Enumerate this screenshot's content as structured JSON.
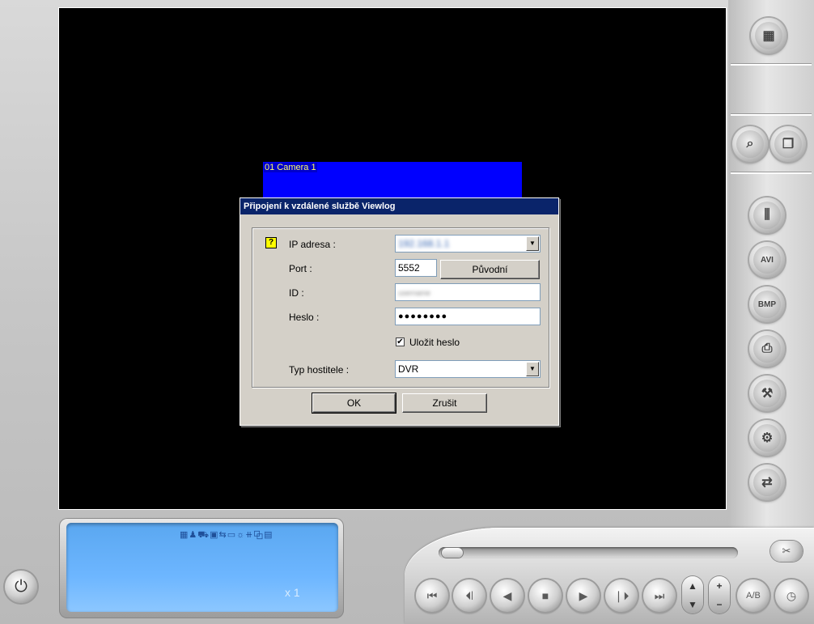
{
  "video": {
    "camera_label": "01 Camera 1"
  },
  "dialog": {
    "title": "Připojení k vzdálené službě Viewlog",
    "ip_label": "IP adresa :",
    "ip_value": "192.168.1.1",
    "port_label": "Port :",
    "port_value": "5552",
    "default_button": "Původní",
    "id_label": "ID :",
    "id_value": "username",
    "password_label": "Heslo :",
    "password_value": "●●●●●●●●",
    "save_password_label": "Uložit heslo",
    "save_password_checked": "✔",
    "host_type_label": "Typ hostitele :",
    "host_type_value": "DVR",
    "ok_button": "OK",
    "cancel_button": "Zrušit"
  },
  "lcd": {
    "status_icons": "▦♟⛟▣⇆▭☼⧺⧉▤",
    "speed": "x 1"
  },
  "right_buttons": [
    {
      "icon": "layout-grid-icon",
      "glyph": "▦"
    },
    {
      "icon": "search-doc-icon",
      "glyph": "⌕"
    },
    {
      "icon": "copy-doc-icon",
      "glyph": "❐"
    },
    {
      "icon": "sliders-icon",
      "glyph": "⫼"
    },
    {
      "icon": "avi-save-icon",
      "glyph": "AVI"
    },
    {
      "icon": "bmp-save-icon",
      "glyph": "BMP"
    },
    {
      "icon": "printer-icon",
      "glyph": "⎙"
    },
    {
      "icon": "tools-icon",
      "glyph": "⚒"
    },
    {
      "icon": "settings-wrench-icon",
      "glyph": "⚙"
    },
    {
      "icon": "remote-connect-icon",
      "glyph": "⇄"
    }
  ],
  "transport": {
    "first": "⏮",
    "prev_frame": "⏴❘",
    "rewind": "◀",
    "stop": "■",
    "play": "▶",
    "next_frame": "❘⏵",
    "last": "⏭",
    "up": "▲",
    "down": "▼",
    "plus": "+",
    "minus": "−",
    "ab": "A/B",
    "clock": "◷",
    "ab_repeat": "✂",
    "power": "⏻"
  }
}
